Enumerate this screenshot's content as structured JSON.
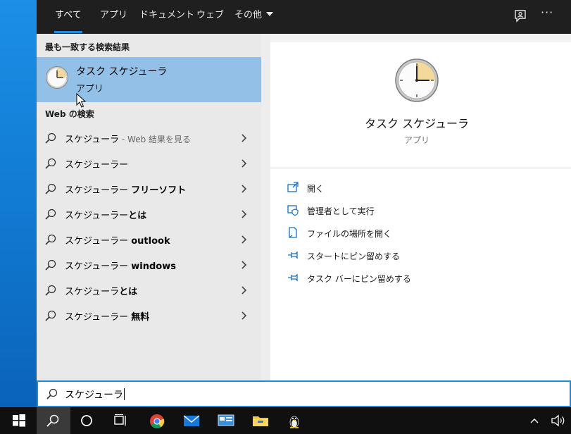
{
  "header": {
    "tabs": [
      "すべて",
      "アプリ",
      "ドキュメント",
      "ウェブ",
      "その他"
    ],
    "feedback_icon": "feedback-icon",
    "more_icon": "more-icon",
    "more_label": "···"
  },
  "left": {
    "best_match_heading": "最も一致する検索結果",
    "best_match": {
      "title": "タスク スケジューラ",
      "subtitle": "アプリ",
      "icon": "task-scheduler-clock-icon"
    },
    "web_heading": "Web の検索",
    "web_results": [
      {
        "query": "スケジューラ",
        "suffix": " - Web 結果を見る"
      },
      {
        "query": "スケジューラー",
        "suffix": ""
      },
      {
        "query": "スケジューラー ",
        "suffix": "フリーソフト"
      },
      {
        "query": "スケジューラー",
        "suffix": "とは"
      },
      {
        "query": "スケジューラー ",
        "suffix": "outlook"
      },
      {
        "query": "スケジューラー ",
        "suffix": "windows"
      },
      {
        "query": "スケジューラ",
        "suffix": "とは"
      },
      {
        "query": "スケジューラー ",
        "suffix": "無料"
      }
    ]
  },
  "preview": {
    "title": "タスク スケジューラ",
    "subtitle": "アプリ",
    "actions": [
      {
        "label": "開く",
        "icon": "open-icon"
      },
      {
        "label": "管理者として実行",
        "icon": "run-as-admin-icon"
      },
      {
        "label": "ファイルの場所を開く",
        "icon": "open-file-location-icon"
      },
      {
        "label": "スタートにピン留めする",
        "icon": "pin-icon"
      },
      {
        "label": "タスク バーにピン留めする",
        "icon": "pin-icon"
      }
    ]
  },
  "search": {
    "value": "スケジューラ"
  },
  "taskbar": {
    "items": [
      "windows-start-icon",
      "search-icon",
      "cortana-circle-icon",
      "task-view-icon",
      "chrome-icon",
      "mail-icon",
      "control-panel-icon",
      "file-explorer-icon",
      "linux-penguin-icon"
    ],
    "tray": [
      "chevron-up-icon",
      "speaker-icon"
    ]
  },
  "colors": {
    "accent": "#1a8ae0",
    "selection": "#93c0e7",
    "header_bg": "#1f1f1f",
    "taskbar_bg": "#101010"
  }
}
